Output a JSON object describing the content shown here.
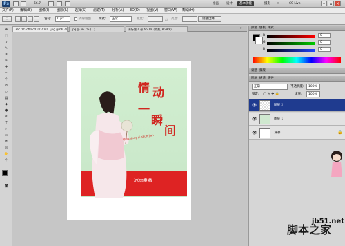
{
  "appbar": {
    "logo": "Ps",
    "zoom": "66.7",
    "workspaces": [
      "基本功能",
      "设计",
      "绘画",
      "摄影"
    ],
    "active_workspace": "基本功能",
    "cs_live": "CS Live"
  },
  "menu": [
    "文件(F)",
    "编辑(E)",
    "图像(I)",
    "图层(L)",
    "选择(S)",
    "滤镜(T)",
    "分析(A)",
    "3D(D)",
    "视图(V)",
    "窗口(W)",
    "帮助(H)"
  ],
  "options": {
    "feather_label": "羽化:",
    "feather_value": "0 px",
    "antialias_label": "消除锯齿",
    "style_label": "样式:",
    "style_value": "正常",
    "width_label": "宽度:",
    "height_label": "高度:",
    "refine_button": "调整边缘..."
  },
  "document_tabs": [
    {
      "label": "3ac79f3df8dcd10070da...jpg @ 66.7% (图层 2, RGB/8)",
      "active": true
    },
    {
      "label": "jpg @ 66.7% (...)",
      "active": false
    },
    {
      "label": "未标题-1 @ 66.7% (背景, RGB/8)",
      "active": false
    }
  ],
  "artwork": {
    "title_lines": [
      "情",
      "动",
      "一",
      "瞬",
      "间"
    ],
    "pinyin": "Qing dong yi shun jian",
    "author": "冰雨❁著"
  },
  "color_panel": {
    "tabs": [
      "颜色",
      "色板",
      "样式"
    ],
    "sliders": [
      {
        "label": "R",
        "value": "0",
        "color": "#e02020"
      },
      {
        "label": "G",
        "value": "0",
        "color": "#20b020"
      },
      {
        "label": "B",
        "value": "0",
        "color": "#2040d0"
      }
    ]
  },
  "adjust_panel": {
    "tabs": [
      "调整",
      "蒙版"
    ]
  },
  "layers_panel": {
    "tabs": [
      "图层",
      "通道",
      "路径"
    ],
    "blend_mode": "正常",
    "opacity_label": "不透明度:",
    "opacity_value": "100%",
    "lock_label": "锁定:",
    "fill_label": "填充:",
    "fill_value": "100%",
    "layers": [
      {
        "name": "图层 2",
        "selected": true
      },
      {
        "name": "图层 1",
        "selected": false
      },
      {
        "name": "背景",
        "selected": false
      }
    ]
  },
  "watermark": {
    "url": "jb51.net",
    "text": "脚本之家"
  }
}
